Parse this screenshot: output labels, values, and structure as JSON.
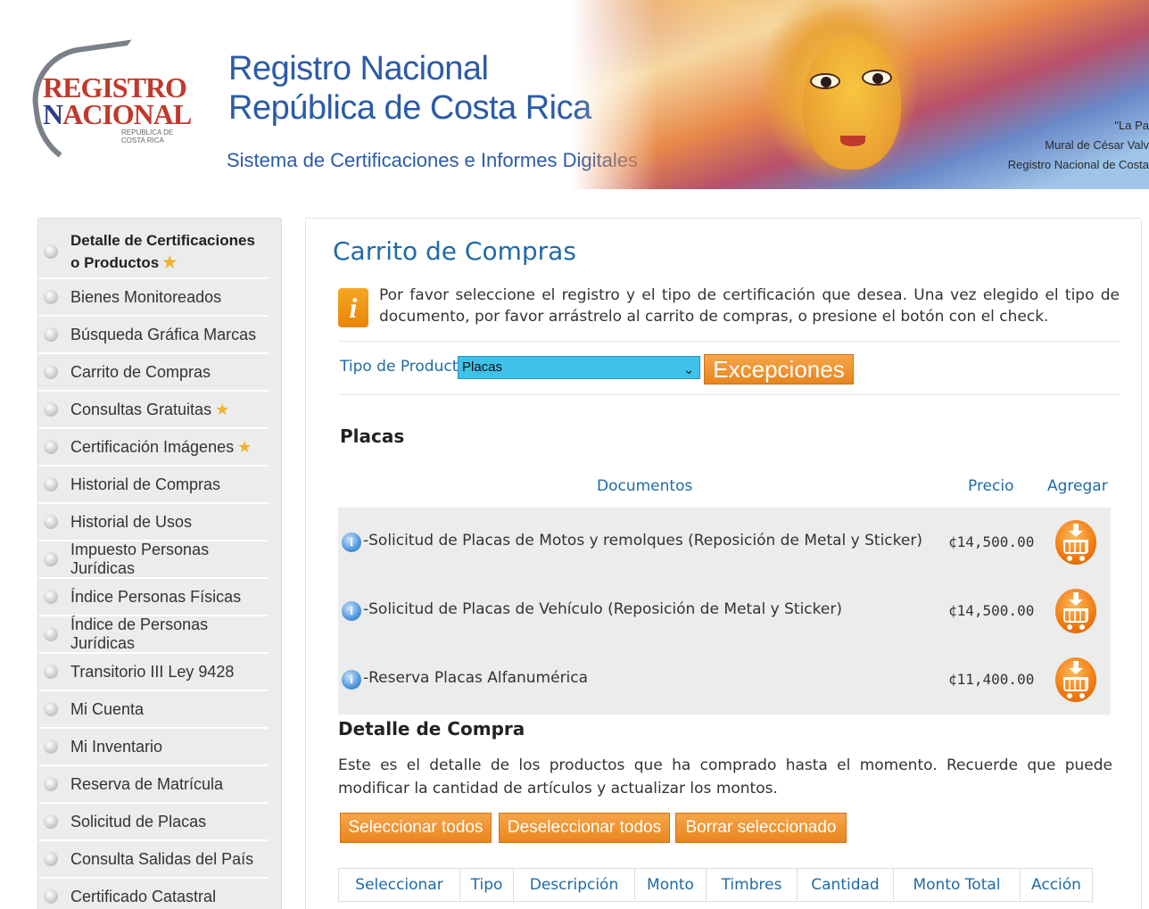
{
  "header": {
    "logo": {
      "line1": "EGISTRO",
      "line1_initial": "R",
      "line2": "ACIONAL",
      "line2_initial": "N",
      "sub1": "REPUBLICA DE",
      "sub2": "COSTA RICA"
    },
    "title_line1": "Registro Nacional",
    "title_line2": "República de Costa Rica",
    "subtitle": "Sistema de Certificaciones e Informes Digitales",
    "mural_caption": {
      "line1": "\"La Pa",
      "line2": "Mural de César Valv",
      "line3": "Registro Nacional de Costa"
    }
  },
  "sidebar": {
    "items": [
      {
        "label": "Detalle de Certificaciones o Productos",
        "star": true
      },
      {
        "label": "Bienes Monitoreados",
        "star": false
      },
      {
        "label": "Búsqueda Gráfica Marcas",
        "star": false
      },
      {
        "label": "Carrito de Compras",
        "star": false
      },
      {
        "label": "Consultas Gratuitas",
        "star": true
      },
      {
        "label": "Certificación Imágenes",
        "star": true
      },
      {
        "label": "Historial de Compras",
        "star": false
      },
      {
        "label": "Historial de Usos",
        "star": false
      },
      {
        "label": "Impuesto Personas Jurídicas",
        "star": false
      },
      {
        "label": "Índice Personas Físicas",
        "star": false
      },
      {
        "label": "Índice de Personas Jurídicas",
        "star": false
      },
      {
        "label": "Transitorio III Ley 9428",
        "star": false
      },
      {
        "label": "Mi Cuenta",
        "star": false
      },
      {
        "label": "Mi Inventario",
        "star": false
      },
      {
        "label": "Reserva de Matrícula",
        "star": false
      },
      {
        "label": "Solicitud de Placas",
        "star": false
      },
      {
        "label": "Consulta Salidas del País",
        "star": false
      },
      {
        "label": "Certificado Catastral",
        "star": false
      }
    ]
  },
  "main": {
    "title": "Carrito de Compras",
    "info_icon_glyph": "i",
    "info_text": "Por favor seleccione el registro y el tipo de certificación que desea. Una vez elegido el tipo de documento, por favor arrástrelo al carrito de compras, o presione el botón con el check.",
    "filter": {
      "label": "Tipo de Producto",
      "selected": "Placas",
      "exceptions_button": "Excepciones"
    },
    "section_title": "Placas",
    "documents_header": {
      "documents": "Documentos",
      "price": "Precio",
      "add": "Agregar"
    },
    "documents": [
      {
        "description": "-Solicitud de Placas de Motos y remolques (Reposición de Metal y Sticker)",
        "price": "¢14,500.00"
      },
      {
        "description": "-Solicitud de Placas de Vehículo (Reposición de Metal y Sticker)",
        "price": "¢14,500.00"
      },
      {
        "description": "-Reserva Placas Alfanumérica",
        "price": "¢11,400.00"
      }
    ],
    "purchase_detail": {
      "title": "Detalle de Compra",
      "text": "Este es el detalle de los productos que ha comprado hasta el momento. Recuerde que puede modificar la cantidad de artículos y actualizar los montos.",
      "buttons": {
        "select_all": "Seleccionar todos",
        "deselect_all": "Deseleccionar todos",
        "delete_selected": "Borrar seleccionado"
      },
      "columns": [
        "Seleccionar",
        "Tipo",
        "Descripción",
        "Monto",
        "Timbres",
        "Cantidad",
        "Monto Total",
        "Acción"
      ]
    }
  },
  "colors": {
    "accent_blue": "#1f6aa8",
    "orange": "#e8861e",
    "select_blue": "#3fc1ea",
    "sidebar_bg": "#ececec"
  }
}
